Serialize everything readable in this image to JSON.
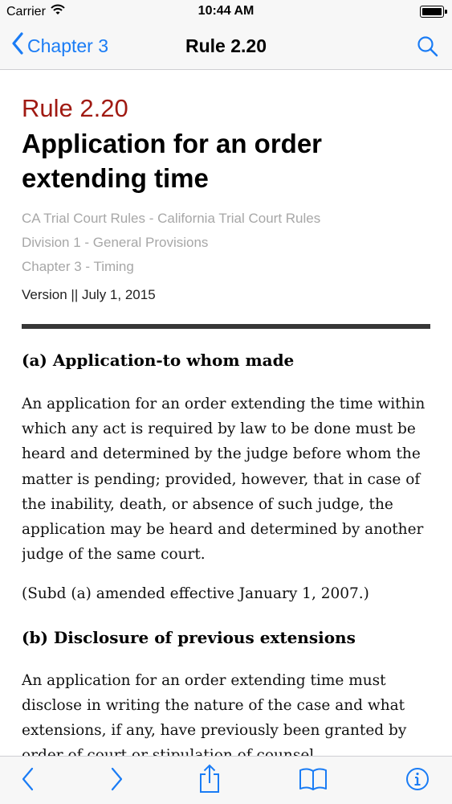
{
  "status_bar": {
    "carrier": "Carrier",
    "time": "10:44 AM",
    "battery_level": 1.0
  },
  "nav_bar": {
    "back_label": "Chapter 3",
    "title": "Rule 2.20",
    "back_icon": "chevron-left-icon",
    "search_icon": "search-icon"
  },
  "article": {
    "rule_number": "Rule 2.20",
    "title": "Application for an order extending time",
    "breadcrumbs": [
      "CA Trial Court Rules - California Trial Court Rules",
      "Division 1 - General Provisions",
      "Chapter 3 - Timing"
    ],
    "version": "Version || July 1, 2015",
    "sections": [
      {
        "heading": "(a) Application-to whom made",
        "paragraphs": [
          "An application for an order extending the time within which any act is required by law to be done must be heard and determined by the judge before whom the matter is pending; provided, however, that in case of the inability, death, or absence of such judge, the application may be heard and determined by another judge of the same court.",
          "(Subd (a) amended effective January 1, 2007.)"
        ]
      },
      {
        "heading": "(b) Disclosure of previous extensions",
        "paragraphs": [
          "An application for an order extending time must disclose in writing the nature of the case and what extensions, if any, have previously been granted by order of court or stipulation of counsel."
        ]
      }
    ]
  },
  "toolbar": {
    "icons": [
      "back-arrow-icon",
      "forward-arrow-icon",
      "share-icon",
      "bookmarks-icon",
      "info-icon"
    ]
  },
  "colors": {
    "accent": "#1a7cf5",
    "rule_number": "#a01a12",
    "muted_text": "#a7a7a7",
    "divider": "#373737",
    "bar_background": "#f7f7f7"
  }
}
